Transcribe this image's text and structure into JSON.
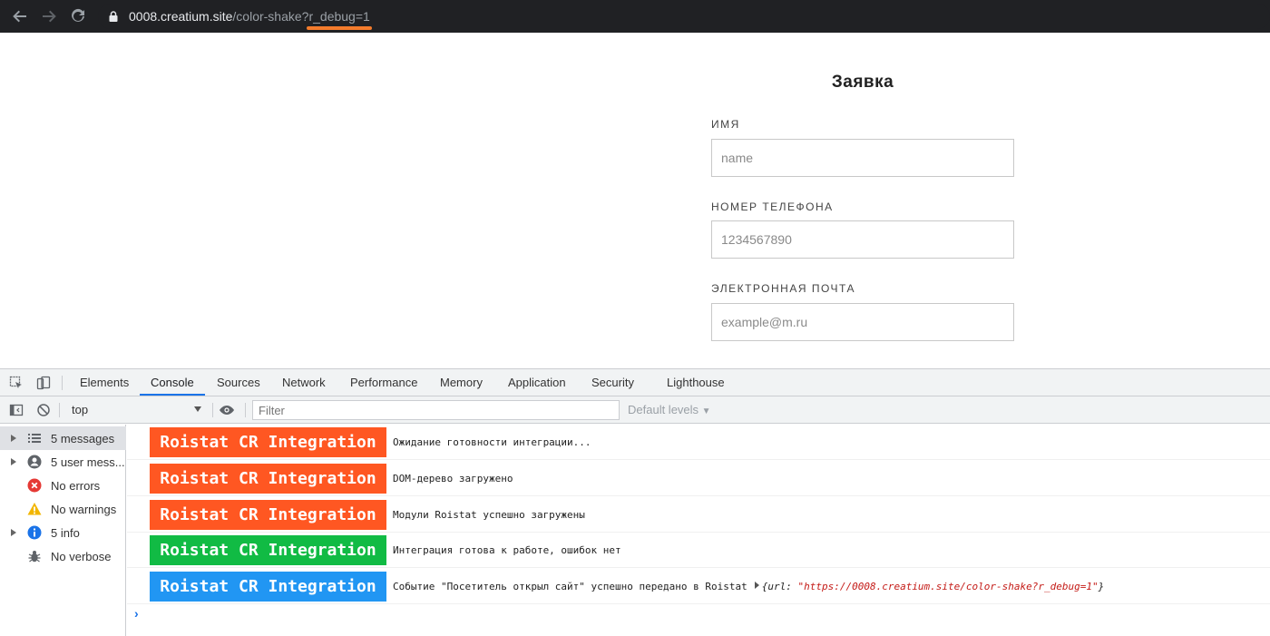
{
  "browser": {
    "url_host": "0008.creatium.site",
    "url_path": "/color-shake?",
    "url_query": "r_debug=1",
    "accent_color": "#f47c2c"
  },
  "form": {
    "title": "Заявка",
    "name_label": "ИМЯ",
    "name_placeholder": "name",
    "phone_label": "НОМЕР ТЕЛЕФОНА",
    "phone_placeholder": "1234567890",
    "email_label": "ЭЛЕКТРОННАЯ ПОЧТА",
    "email_placeholder": "example@m.ru"
  },
  "devtools": {
    "tabs": [
      "Elements",
      "Console",
      "Sources",
      "Network",
      "Performance",
      "Memory",
      "Application",
      "Security",
      "Lighthouse"
    ],
    "active_tab": "Console",
    "context": "top",
    "filter_placeholder": "Filter",
    "levels_label": "Default levels",
    "sidebar": [
      {
        "label": "5 messages",
        "icon": "list-icon",
        "expandable": true,
        "selected": true
      },
      {
        "label": "5 user mess...",
        "icon": "user-icon",
        "expandable": true,
        "selected": false
      },
      {
        "label": "No errors",
        "icon": "error-icon",
        "expandable": false,
        "selected": false
      },
      {
        "label": "No warnings",
        "icon": "warning-icon",
        "expandable": false,
        "selected": false
      },
      {
        "label": "5 info",
        "icon": "info-icon",
        "expandable": true,
        "selected": false
      },
      {
        "label": "No verbose",
        "icon": "bug-icon",
        "expandable": false,
        "selected": false
      }
    ],
    "messages": [
      {
        "badge": "Roistat CR Integration",
        "color": "#ff5722",
        "text": "Ожидание готовности интеграции..."
      },
      {
        "badge": "Roistat CR Integration",
        "color": "#ff5722",
        "text": "DOM-дерево загружено"
      },
      {
        "badge": "Roistat CR Integration",
        "color": "#ff5722",
        "text": "Модули Roistat успешно загружены"
      },
      {
        "badge": "Roistat CR Integration",
        "color": "#11bb44",
        "text": "Интеграция готова к работе, ошибок нет"
      },
      {
        "badge": "Roistat CR Integration",
        "color": "#2196f3",
        "text": "Событие \"Посетитель открыл сайт\" успешно передано в Roistat",
        "object_key": "{url: ",
        "object_value": "\"https://0008.creatium.site/color-shake?r_debug=1\"",
        "object_close": "}"
      }
    ]
  }
}
